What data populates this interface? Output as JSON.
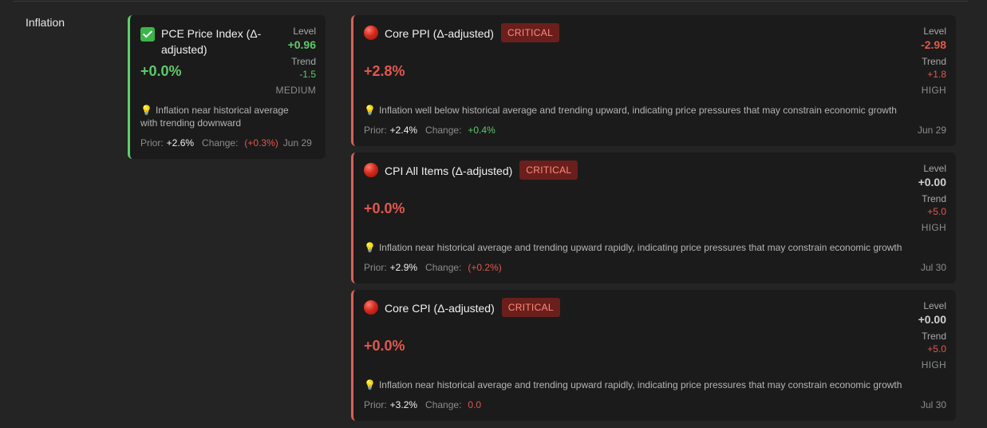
{
  "section": {
    "label": "Inflation"
  },
  "labels": {
    "level": "Level",
    "trend": "Trend",
    "prior": "Prior:",
    "change": "Change:",
    "bulb": "💡"
  },
  "cards": [
    {
      "title": "PCE Price Index (Δ-adjusted)",
      "status": "ok",
      "badge": "",
      "change_pct": "+0.0%",
      "level": "+0.96",
      "trend": "-1.5",
      "severity": "MEDIUM",
      "insight": "Inflation near historical average with trending downward",
      "prior": "+2.6%",
      "change": "(+0.3%)",
      "date": "Jun 29"
    },
    {
      "title": "Core PPI (Δ-adjusted)",
      "status": "critical",
      "badge": "CRITICAL",
      "change_pct": "+2.8%",
      "level": "-2.98",
      "trend": "+1.8",
      "severity": "HIGH",
      "insight": "Inflation well below historical average and trending upward, indicating price pressures that may constrain economic growth",
      "prior": "+2.4%",
      "change": "+0.4%",
      "date": "Jun 29"
    },
    {
      "title": "CPI All Items (Δ-adjusted)",
      "status": "critical",
      "badge": "CRITICAL",
      "change_pct": "+0.0%",
      "level": "+0.00",
      "trend": "+5.0",
      "severity": "HIGH",
      "insight": "Inflation near historical average and trending upward rapidly, indicating price pressures that may constrain economic growth",
      "prior": "+2.9%",
      "change": "(+0.2%)",
      "date": "Jul 30"
    },
    {
      "title": "Core CPI (Δ-adjusted)",
      "status": "critical",
      "badge": "CRITICAL",
      "change_pct": "+0.0%",
      "level": "+0.00",
      "trend": "+5.0",
      "severity": "HIGH",
      "insight": "Inflation near historical average and trending upward rapidly, indicating price pressures that may constrain economic growth",
      "prior": "+3.2%",
      "change": "0.0",
      "date": "Jul 30"
    }
  ],
  "colors": {
    "positive": "#5cc96a",
    "negative": "#e1584f",
    "critical_badge_bg": "#6b1f1c",
    "critical_badge_text": "#ff8b7e",
    "ok_border": "#5fcf6a",
    "critical_border": "#d9605a"
  }
}
